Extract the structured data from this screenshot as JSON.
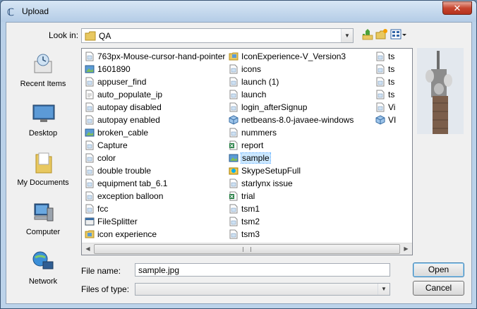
{
  "window": {
    "title": "Upload",
    "close_label": "✕"
  },
  "lookin": {
    "label": "Look in:",
    "value": "QA"
  },
  "places": [
    {
      "label": "Recent Items",
      "icon": "recent-items-icon"
    },
    {
      "label": "Desktop",
      "icon": "desktop-icon"
    },
    {
      "label": "My Documents",
      "icon": "my-documents-icon"
    },
    {
      "label": "Computer",
      "icon": "computer-icon"
    },
    {
      "label": "Network",
      "icon": "network-icon"
    }
  ],
  "files": {
    "col1": [
      {
        "name": "763px-Mouse-cursor-hand-pointer",
        "type": "image"
      },
      {
        "name": "1601890",
        "type": "picture"
      },
      {
        "name": "appuser_find",
        "type": "image"
      },
      {
        "name": "auto_populate_ip",
        "type": "doc"
      },
      {
        "name": "autopay disabled",
        "type": "image"
      },
      {
        "name": "autopay enabled",
        "type": "image"
      },
      {
        "name": "broken_cable",
        "type": "picture"
      },
      {
        "name": "Capture",
        "type": "image"
      },
      {
        "name": "color",
        "type": "image"
      },
      {
        "name": "double trouble",
        "type": "image"
      },
      {
        "name": "equipment tab_6.1",
        "type": "image"
      },
      {
        "name": "exception balloon",
        "type": "image"
      },
      {
        "name": "fcc",
        "type": "image"
      },
      {
        "name": "FileSplitter",
        "type": "app"
      },
      {
        "name": "icon experience",
        "type": "folder-image"
      }
    ],
    "col2": [
      {
        "name": "IconExperience-V_Version3",
        "type": "folder"
      },
      {
        "name": "icons",
        "type": "image"
      },
      {
        "name": "launch (1)",
        "type": "image"
      },
      {
        "name": "launch",
        "type": "image"
      },
      {
        "name": "login_afterSignup",
        "type": "image"
      },
      {
        "name": "netbeans-8.0-javaee-windows",
        "type": "installer"
      },
      {
        "name": "nummers",
        "type": "image"
      },
      {
        "name": "report",
        "type": "excel"
      },
      {
        "name": "sample",
        "type": "picture",
        "selected": true
      },
      {
        "name": "SkypeSetupFull",
        "type": "setup"
      },
      {
        "name": "starlynx issue",
        "type": "image"
      },
      {
        "name": "trial",
        "type": "excel"
      },
      {
        "name": "tsm1",
        "type": "image"
      },
      {
        "name": "tsm2",
        "type": "image"
      },
      {
        "name": "tsm3",
        "type": "image"
      }
    ],
    "col3": [
      {
        "name": "ts",
        "type": "image"
      },
      {
        "name": "ts",
        "type": "image"
      },
      {
        "name": "ts",
        "type": "image"
      },
      {
        "name": "ts",
        "type": "image"
      },
      {
        "name": "Vi",
        "type": "image"
      },
      {
        "name": "VI",
        "type": "installer"
      }
    ]
  },
  "filename": {
    "label": "File name:",
    "value": "sample.jpg"
  },
  "filetype": {
    "label": "Files of type:",
    "value": ""
  },
  "buttons": {
    "open": "Open",
    "cancel": "Cancel"
  },
  "colors": {
    "selection": "#cce8ff",
    "titlebar": "#b9d0e8",
    "close": "#c7452f"
  }
}
